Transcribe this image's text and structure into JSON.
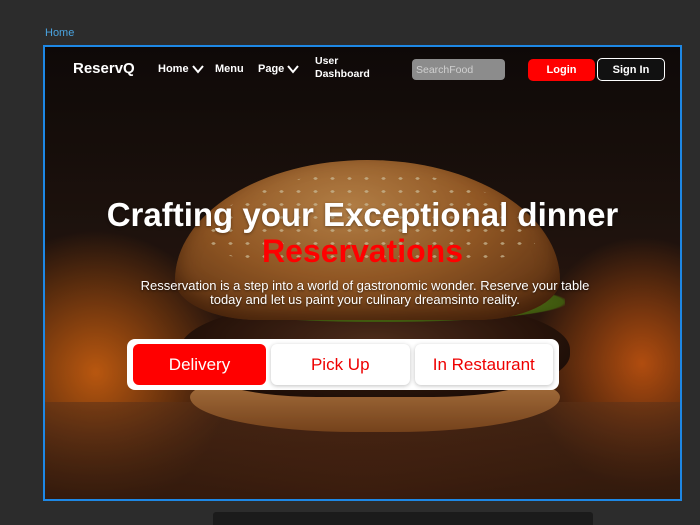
{
  "frame": {
    "label": "Home"
  },
  "header": {
    "logo": "ReservQ",
    "nav": {
      "home": "Home",
      "menu": "Menu",
      "page": "Page",
      "dashboard_line1": "User",
      "dashboard_line2": "Dashboard"
    },
    "search": {
      "placeholder": "SearchFood"
    },
    "login_label": "Login",
    "signin_label": "Sign In"
  },
  "hero": {
    "headline": "Crafting your Exceptional dinner",
    "headline_accent": "Reservations",
    "subtitle": "Resservation is a step into a world of gastronomic wonder. Reserve your table today and let us paint your culinary dreamsinto reality.",
    "options": [
      "Delivery",
      "Pick Up",
      "In Restaurant"
    ],
    "selected_option": "Delivery"
  },
  "colors": {
    "accent": "#ff0000",
    "frame_border": "#1e88e5",
    "canvas_bg": "#2c2c2c"
  }
}
